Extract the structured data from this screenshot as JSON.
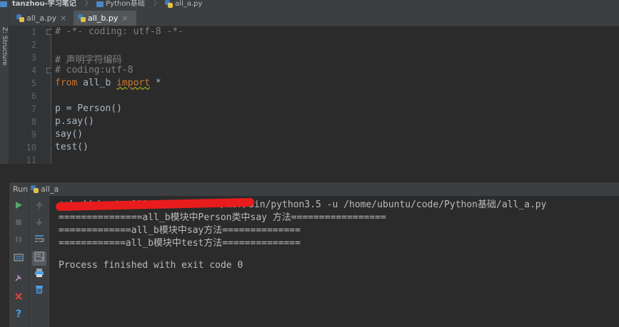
{
  "breadcrumb": {
    "project": "tanzhou-学习笔记",
    "folder": "Python基础",
    "file": "all_a.py"
  },
  "structure_tab": {
    "label": "Z: Structure"
  },
  "editor_tabs": [
    {
      "label": "all_a.py",
      "close": "×",
      "active": false
    },
    {
      "label": "all_b.py",
      "close": "×",
      "active": true
    }
  ],
  "line_numbers": [
    "1",
    "2",
    "3",
    "4",
    "5",
    "6",
    "7",
    "8",
    "9",
    "10",
    "11"
  ],
  "code": {
    "l1": "# -*- coding: utf-8 -*-",
    "l3": "# 声明字符编码",
    "l4": "# coding:utf-8",
    "l5_kw_from": "from",
    "l5_module": "all_b",
    "l5_kw_import": "import",
    "l5_star": "*",
    "l7": "p = Person()",
    "l8": "p.say()",
    "l9": "say()",
    "l10": "test()"
  },
  "run_panel": {
    "label": "Run",
    "config": "all_a"
  },
  "console": {
    "command": "ssh://ubuntu@192.168.56.22:22/usr/bin/python3.5 -u /home/ubuntu/code/Python基础/all_a.py",
    "out1": "===============all_b模块中Person类中say 方法=================",
    "out2": "=============all_b模块中say方法==============",
    "out3": "============all_b模块中test方法==============",
    "finish": "Process finished with exit code 0"
  },
  "colors": {
    "bg": "#2b2b2b",
    "keyword": "#cc7832",
    "comment": "#808080",
    "run_green": "#59a869",
    "close_red": "#e0443e",
    "help_blue": "#4a9fe8",
    "redaction": "#e81c1c"
  },
  "icons": [
    "run-icon",
    "rerun-up-icon",
    "stop-icon",
    "scroll-down-icon",
    "pause-icon",
    "soft-wrap-icon",
    "dump-threads-icon",
    "scroll-to-end-icon",
    "pin-icon",
    "print-icon",
    "close-icon",
    "trash-icon",
    "help-icon"
  ]
}
